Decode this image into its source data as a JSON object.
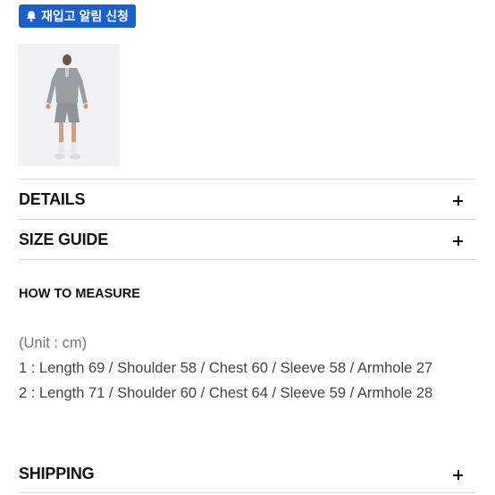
{
  "restock_button": {
    "label": "재입고 알림 신청",
    "icon": "bell-icon",
    "color": "#1a5fd0"
  },
  "product_image": {
    "alt": "product-model-photo"
  },
  "accordion": {
    "details": {
      "label": "DETAILS"
    },
    "size_guide": {
      "label": "SIZE GUIDE"
    },
    "shipping": {
      "label": "SHIPPING"
    }
  },
  "size_guide_content": {
    "heading": "HOW TO MEASURE",
    "unit": "(Unit : cm)",
    "rows": [
      "1 : Length 69 / Shoulder 58 / Chest 60 / Sleeve 58 / Armhole 27",
      "2 : Length 71 / Shoulder 60 / Chest 64 / Sleeve 59 / Armhole 28"
    ]
  }
}
